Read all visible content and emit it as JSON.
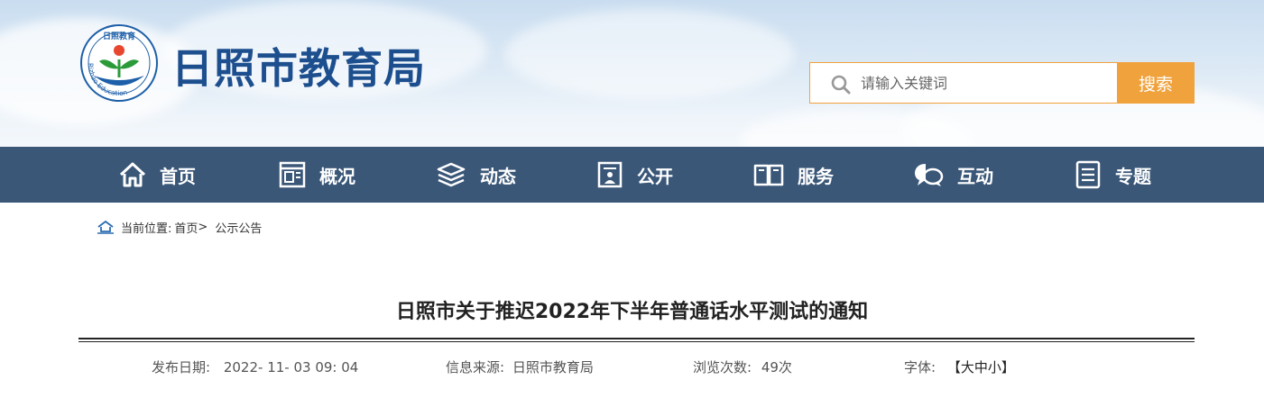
{
  "header": {
    "logo_label": "日照市教育局 logo",
    "logo_text_top": "日照教育",
    "logo_text_arc": "Rizhao Education",
    "site_title": "日照市教育局",
    "search": {
      "placeholder": "请输入关键词",
      "value": "",
      "button_label": "搜索",
      "icon": "search-icon"
    },
    "accent_color": "#f0a23c",
    "title_color": "#1d4f8f"
  },
  "nav": {
    "background": "#3a5778",
    "items": [
      {
        "label": "首页",
        "icon": "home-icon"
      },
      {
        "label": "概况",
        "icon": "window-icon"
      },
      {
        "label": "动态",
        "icon": "layers-icon"
      },
      {
        "label": "公开",
        "icon": "document-person-icon"
      },
      {
        "label": "服务",
        "icon": "book-icon"
      },
      {
        "label": "互动",
        "icon": "chat-bubbles-icon"
      },
      {
        "label": "专题",
        "icon": "notes-icon"
      }
    ]
  },
  "breadcrumb": {
    "prefix": "当前位置:",
    "home": "首页",
    "separator": ">",
    "current": "公示公告",
    "icon": "home-icon"
  },
  "article": {
    "title": "日照市关于推迟2022年下半年普通话水平测试的通知",
    "publish_date_label": "发布日期:",
    "publish_date": "2022- 11- 03 09: 04",
    "source_label": "信息来源:",
    "source": "日照市教育局",
    "views_label": "浏览次数:",
    "views": "49次",
    "font_label": "字体:",
    "font_open": "【",
    "font_large": "大",
    "font_medium": "中",
    "font_small": "小",
    "font_close": "】"
  }
}
